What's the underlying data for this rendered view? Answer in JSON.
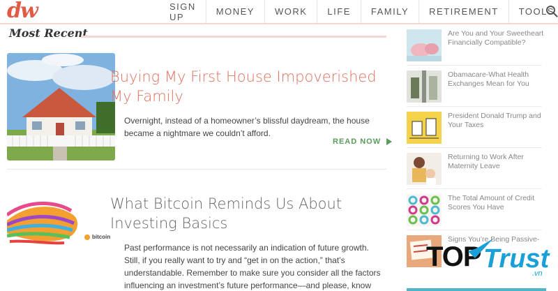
{
  "header": {
    "logo": "dw",
    "nav": [
      "SIGN UP",
      "MONEY",
      "WORK",
      "LIFE",
      "FAMILY",
      "RETIREMENT",
      "TOOLS"
    ]
  },
  "main": {
    "section_title": "Most Recent",
    "articles": [
      {
        "title": "Buying My First House Impoverished My Family",
        "excerpt": "Overnight, instead of a homeowner’s blissful daydream, the house became a nightmare we couldn’t afford.",
        "read_more": "READ NOW",
        "title_color": "#e0705c"
      },
      {
        "title": "What Bitcoin Reminds Us About Investing Basics",
        "excerpt": "Past performance is not necessarily an indication of future growth. Still, if you really want to try and “get in on the action,” that’s understandable. Remember to make sure you consider all the factors influencing an investment’s future performance—and please, know how much risk you can really afford take.",
        "image_caption": "bitcoin",
        "title_color": "#666666"
      }
    ]
  },
  "sidebar": {
    "items": [
      {
        "title": "Are You and Your Sweetheart Financially Compatible?"
      },
      {
        "title": "Obamacare-What Health Exchanges Mean for You"
      },
      {
        "title": "President Donald Trump and Your Taxes"
      },
      {
        "title": "Returning to Work After Maternity Leave"
      },
      {
        "title": "The Total Amount of Credit Scores You Have"
      },
      {
        "title": "Signs You’re Being Passive-"
      }
    ]
  },
  "watermark": {
    "brand_top": "TOP",
    "brand_trust": "Trust",
    "domain": ".vn"
  },
  "icons": {
    "search": "search-icon",
    "read_more_arrow": "play-arrow-icon"
  },
  "colors": {
    "accent": "#e05a45",
    "read_more": "#5a9a5a",
    "rule": "#f4d6d0"
  }
}
